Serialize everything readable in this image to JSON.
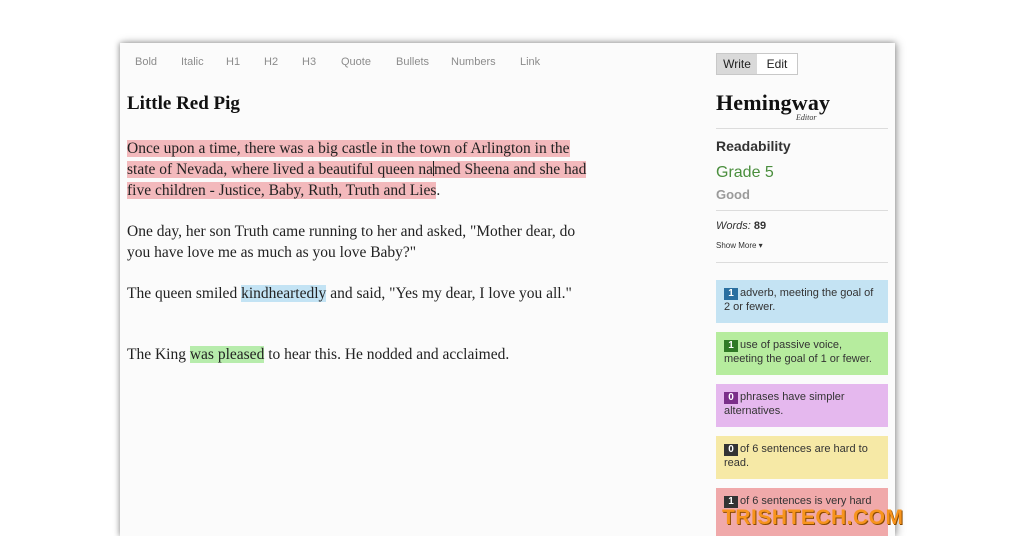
{
  "toolbar": {
    "items": [
      "Bold",
      "Italic",
      "H1",
      "H2",
      "H3",
      "Quote",
      "Bullets",
      "Numbers",
      "Link"
    ]
  },
  "document": {
    "title": "Little Red Pig",
    "p1": {
      "highlight_a": "Once upon a time, there was a big castle in the town of Arlington in the state of Nevada, where lived a beautiful queen na",
      "highlight_b": "med Sheena and she had five children - Justice, Baby, Ruth, Truth and Lies",
      "tail": "."
    },
    "p2": {
      "text": "One day, her son Truth came running to her and asked, \"Mother dear, do you have love me as much as you love Baby?\""
    },
    "p3": {
      "before": "The queen smiled ",
      "highlight": "kindheartedly",
      "after": " and said, \"Yes my dear, I love you all.\""
    },
    "p4": {
      "before": "The King ",
      "highlight": "was pleased",
      "after": " to hear this. He nodded and acclaimed."
    }
  },
  "sidebar": {
    "mode": {
      "write": "Write",
      "edit": "Edit",
      "active": "write"
    },
    "logo": {
      "name": "Hemingway",
      "sub": "Editor"
    },
    "readability": {
      "label": "Readability",
      "grade": "Grade 5",
      "desc": "Good"
    },
    "words": {
      "label": "Words:",
      "value": "89"
    },
    "show_more": "Show More ▾",
    "cards": [
      {
        "count": "1",
        "text": "adverb, meeting the goal of 2 or fewer.",
        "bg": "#c4e3f3",
        "badge": "#2a6fa0"
      },
      {
        "count": "1",
        "text": "use of passive voice, meeting the goal of 1 or fewer.",
        "bg": "#b6ec9e",
        "badge": "#2f7a25"
      },
      {
        "count": "0",
        "text": "phrases have simpler alternatives.",
        "bg": "#e5b8ee",
        "badge": "#7b2f8a"
      },
      {
        "count": "0",
        "text": "of 6 sentences are hard to read.",
        "bg": "#f6e9a6",
        "badge": "#333333"
      },
      {
        "count": "1",
        "text": "of 6 sentences is very hard",
        "bg": "#f0a9aa",
        "badge": "#333333"
      }
    ]
  },
  "watermark": "TRISHTECH.COM"
}
